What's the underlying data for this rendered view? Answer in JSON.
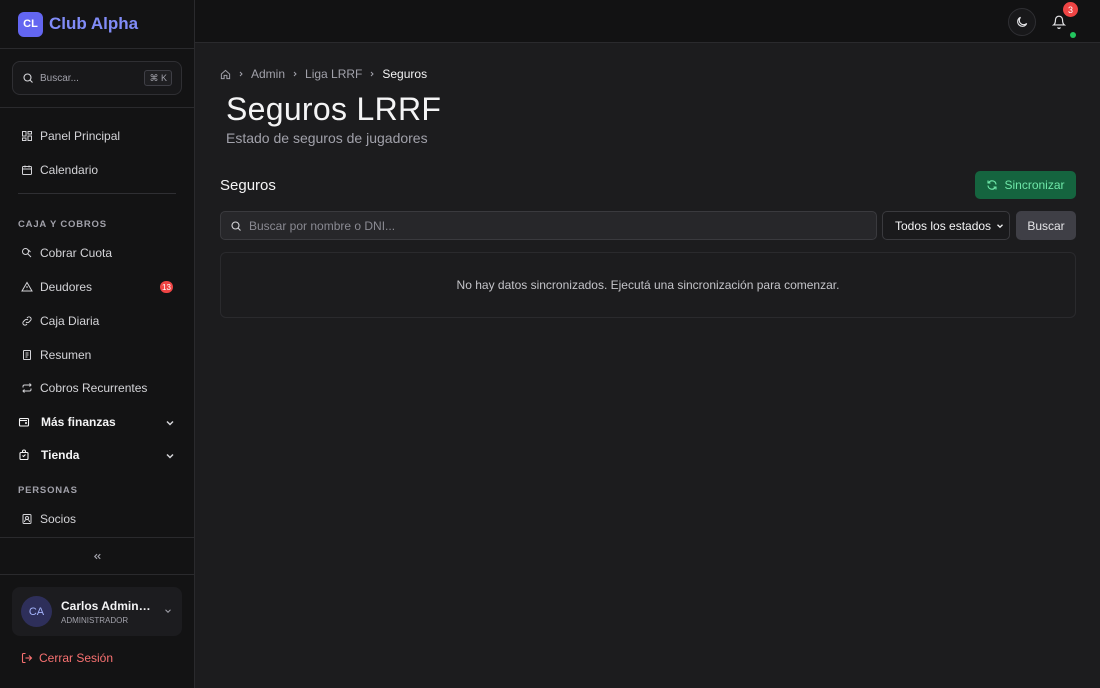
{
  "app": {
    "logo_initials": "CL",
    "name": "Club Alpha"
  },
  "sidebar": {
    "search": {
      "placeholder": "Buscar...",
      "shortcut": "⌘ K"
    },
    "items_top": [
      {
        "label": "Panel Principal",
        "icon": "grid-icon"
      },
      {
        "label": "Calendario",
        "icon": "calendar-icon"
      }
    ],
    "section_finance": "CAJA Y COBROS",
    "items_finance": [
      {
        "label": "Cobrar Cuota",
        "icon": "coins-icon"
      },
      {
        "label": "Deudores",
        "icon": "warning-icon",
        "badge": "13"
      },
      {
        "label": "Caja Diaria",
        "icon": "link-icon"
      },
      {
        "label": "Resumen",
        "icon": "receipt-icon"
      },
      {
        "label": "Cobros Recurrentes",
        "icon": "repeat-icon"
      }
    ],
    "groups": [
      {
        "label": "Más finanzas",
        "icon": "wallet-icon"
      },
      {
        "label": "Tienda",
        "icon": "bag-icon"
      }
    ],
    "section_people": "PERSONAS",
    "items_people": [
      {
        "label": "Socios",
        "icon": "id-card-icon"
      }
    ],
    "user": {
      "initials": "CA",
      "name": "Carlos Adminis...",
      "role": "ADMINISTRADOR"
    },
    "logout_label": "Cerrar Sesión"
  },
  "topbar": {
    "notifications_count": "3"
  },
  "breadcrumb": {
    "items": [
      "Admin",
      "Liga LRRF"
    ],
    "current": "Seguros"
  },
  "page": {
    "title": "Seguros LRRF",
    "subtitle": "Estado de seguros de jugadores",
    "section_title": "Seguros",
    "sync_label": "Sincronizar",
    "filter_placeholder": "Buscar por nombre o DNI...",
    "status_selected": "Todos los estados",
    "search_label": "Buscar",
    "empty_message": "No hay datos sincronizados. Ejecutá una sincronización para comenzar."
  },
  "colors": {
    "accent": "#6366f1",
    "danger": "#ef4444",
    "success": "#15643f"
  }
}
